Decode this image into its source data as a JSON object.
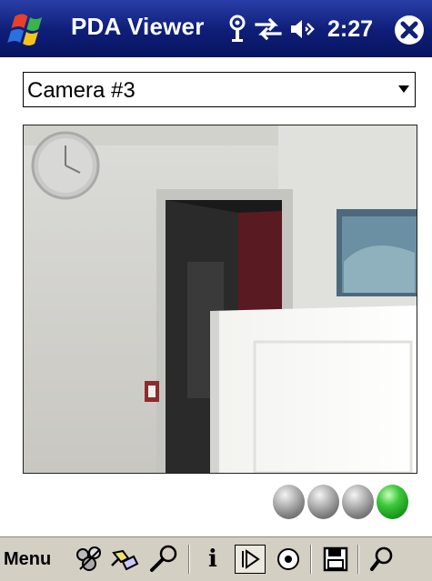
{
  "titlebar": {
    "app_title": "PDA Viewer",
    "time": "2:27"
  },
  "camera_select": {
    "value": "Camera #3"
  },
  "status_indicators": [
    {
      "state": "off",
      "color": "#8a8a8a"
    },
    {
      "state": "off",
      "color": "#8a8a8a"
    },
    {
      "state": "off",
      "color": "#8a8a8a"
    },
    {
      "state": "on",
      "color": "#2fb52c"
    }
  ],
  "toolbar": {
    "menu_label": "Menu",
    "info_label": "i",
    "icons": [
      "network-icon",
      "tools-icon",
      "settings-wrench-icon",
      "info-icon",
      "play-icon",
      "record-icon",
      "save-icon",
      "zoom-icon"
    ]
  },
  "colors": {
    "titlebar_bg": "#0f1f7a",
    "toolbar_bg": "#d4cfc3",
    "active_indicator": "#2fb52c"
  }
}
